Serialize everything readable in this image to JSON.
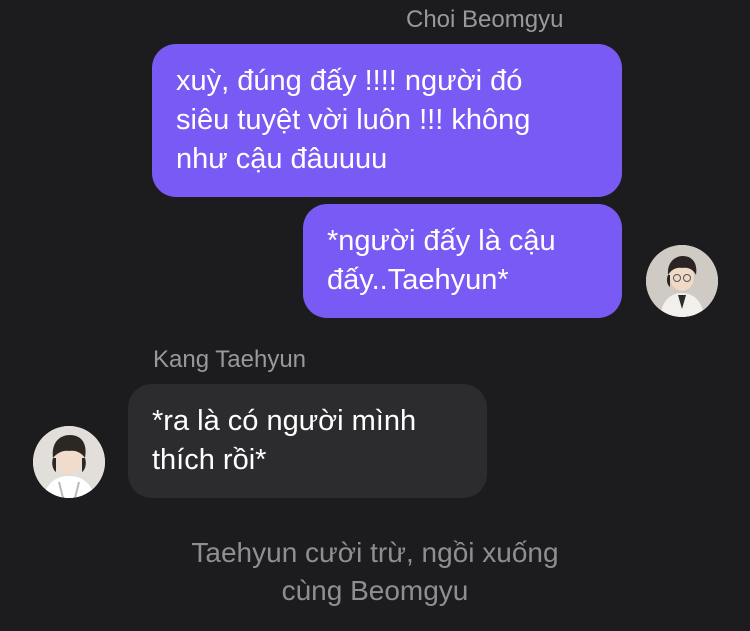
{
  "colors": {
    "background": "#1c1c1e",
    "outgoing_bubble": "#7a5af5",
    "incoming_bubble": "#2c2c2e",
    "name_text": "#98989d",
    "narration_text": "#8e8e93"
  },
  "messages": {
    "outgoing_sender": "Choi Beomgyu",
    "outgoing_1": {
      "lines": [
        "xuỳ, đúng đấy !!!! người đó",
        "siêu tuyệt vời luôn !!! không",
        "như cậu đâuuuu"
      ]
    },
    "outgoing_2": {
      "lines": [
        "*người đấy là cậu",
        "đấy..Taehyun*"
      ]
    },
    "outgoing_avatar_icon": "avatar-photo-icon",
    "incoming_sender": "Kang Taehyun",
    "incoming_1": {
      "lines": [
        "*ra là có người mình",
        "thích rồi*"
      ]
    },
    "incoming_avatar_icon": "avatar-photo-icon"
  },
  "narration": {
    "lines": [
      "Taehyun cười trừ, ngồi xuống",
      "cùng Beomgyu"
    ]
  }
}
